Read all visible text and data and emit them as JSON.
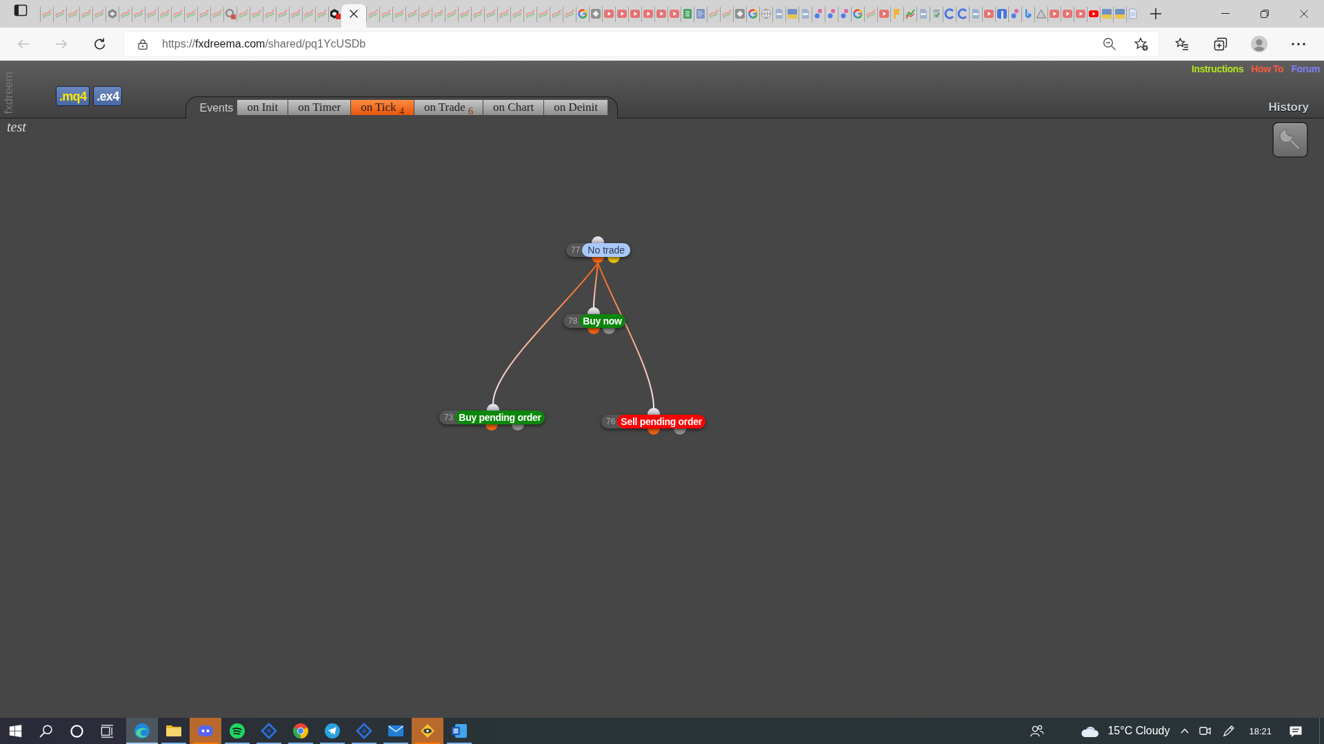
{
  "browser": {
    "tabs": [
      {
        "kind": "fx",
        "selected": false
      },
      {
        "kind": "fx",
        "selected": false
      },
      {
        "kind": "fx",
        "selected": false
      },
      {
        "kind": "fx",
        "selected": false
      },
      {
        "kind": "fx",
        "selected": false
      },
      {
        "kind": "hex",
        "selected": false
      },
      {
        "kind": "fx",
        "selected": false
      },
      {
        "kind": "fx",
        "selected": false
      },
      {
        "kind": "fx",
        "selected": false
      },
      {
        "kind": "fx",
        "selected": false
      },
      {
        "kind": "fx",
        "selected": false
      },
      {
        "kind": "fx",
        "selected": false
      },
      {
        "kind": "fx",
        "selected": false
      },
      {
        "kind": "fx",
        "selected": false
      },
      {
        "kind": "ring",
        "selected": false
      },
      {
        "kind": "fx",
        "selected": false
      },
      {
        "kind": "fx",
        "selected": false
      },
      {
        "kind": "fx",
        "selected": false
      },
      {
        "kind": "fx",
        "selected": false
      },
      {
        "kind": "fx",
        "selected": false
      },
      {
        "kind": "fx",
        "selected": false
      },
      {
        "kind": "fx",
        "selected": false
      },
      {
        "kind": "hexbadge",
        "selected": false
      },
      {
        "selected": true
      },
      {
        "kind": "fx",
        "selected": false
      },
      {
        "kind": "fx",
        "selected": false
      },
      {
        "kind": "fx",
        "selected": false
      },
      {
        "kind": "fx",
        "selected": false
      },
      {
        "kind": "fx",
        "selected": false
      },
      {
        "kind": "fx",
        "selected": false
      },
      {
        "kind": "fx",
        "selected": false
      },
      {
        "kind": "fx",
        "selected": false
      },
      {
        "kind": "fx",
        "selected": false
      },
      {
        "kind": "fx",
        "selected": false
      },
      {
        "kind": "fx",
        "selected": false
      },
      {
        "kind": "fx",
        "selected": false
      },
      {
        "kind": "fx",
        "selected": false
      },
      {
        "kind": "fx",
        "selected": false
      },
      {
        "kind": "fx",
        "selected": false
      },
      {
        "kind": "fx",
        "selected": false
      },
      {
        "kind": "g",
        "selected": false
      },
      {
        "kind": "tile",
        "selected": false
      },
      {
        "kind": "play",
        "selected": false
      },
      {
        "kind": "play",
        "selected": false
      },
      {
        "kind": "play",
        "selected": false
      },
      {
        "kind": "play",
        "selected": false
      },
      {
        "kind": "play",
        "selected": false
      },
      {
        "kind": "play",
        "selected": false
      },
      {
        "kind": "sheet",
        "selected": false
      },
      {
        "kind": "doc",
        "selected": false
      },
      {
        "kind": "fx",
        "selected": false
      },
      {
        "kind": "fx",
        "selected": false
      },
      {
        "kind": "tile",
        "selected": false
      },
      {
        "kind": "g",
        "selected": false
      },
      {
        "kind": "globe",
        "selected": false
      },
      {
        "kind": "sql",
        "selected": false
      },
      {
        "kind": "mq5",
        "selected": false
      },
      {
        "kind": "sql",
        "selected": false
      },
      {
        "kind": "dots",
        "selected": false
      },
      {
        "kind": "dots",
        "selected": false
      },
      {
        "kind": "dots",
        "selected": false
      },
      {
        "kind": "g",
        "selected": false
      },
      {
        "kind": "fx",
        "selected": false
      },
      {
        "kind": "play",
        "selected": false
      },
      {
        "kind": "flag",
        "selected": false
      },
      {
        "kind": "chart",
        "selected": false
      },
      {
        "kind": "sql",
        "selected": false
      },
      {
        "kind": "db",
        "selected": false
      },
      {
        "kind": "c",
        "selected": false
      },
      {
        "kind": "c",
        "selected": false
      },
      {
        "kind": "sql",
        "selected": false
      },
      {
        "kind": "play",
        "selected": false
      },
      {
        "kind": "f",
        "selected": false
      },
      {
        "kind": "dots",
        "selected": false
      },
      {
        "kind": "b",
        "selected": false
      },
      {
        "kind": "tri",
        "selected": false
      },
      {
        "kind": "play",
        "selected": false
      },
      {
        "kind": "play",
        "selected": false
      },
      {
        "kind": "play",
        "selected": false
      },
      {
        "kind": "yt",
        "selected": false
      },
      {
        "kind": "mq5",
        "selected": false
      },
      {
        "kind": "mq5",
        "selected": false
      },
      {
        "kind": "page",
        "selected": false
      }
    ],
    "back": {
      "disabled": true
    },
    "forward": {
      "disabled": true
    },
    "address": {
      "prefix": "https://",
      "domain": "fxdreema.com",
      "rest": "/shared/pq1YcUSDb"
    }
  },
  "page": {
    "brand": "fxdreem",
    "files": [
      {
        "label": ".mq4",
        "color": "#ffe600"
      },
      {
        "label": ".ex4",
        "color": "#ffffff"
      }
    ],
    "events": {
      "label": "Events",
      "tabs": [
        {
          "label": "on Init",
          "selected": false
        },
        {
          "label": "on Timer",
          "selected": false
        },
        {
          "label": "on Tick",
          "count": "4",
          "selected": true
        },
        {
          "label": "on Trade",
          "count": "6",
          "selected": false
        },
        {
          "label": "on Chart",
          "selected": false
        },
        {
          "label": "on Deinit",
          "selected": false
        }
      ]
    },
    "links": [
      {
        "label": "Instructions",
        "color": "#b4e61e"
      },
      {
        "label": "How To",
        "color": "#ff5a3c"
      },
      {
        "label": "Forum",
        "color": "#7f7fff"
      }
    ],
    "history": "History",
    "project": "test"
  },
  "diagram": {
    "blocks": [
      {
        "number": "77",
        "label": "No trade",
        "kind": "condition",
        "color": "#a9c9fb",
        "children": [
          {
            "number": "78",
            "label": "Buy now",
            "kind": "action",
            "color": "#0b870b"
          },
          {
            "number": "73",
            "label": "Buy pending order",
            "kind": "action",
            "color": "#0b870b"
          },
          {
            "number": "76",
            "label": "Sell pending order",
            "kind": "action",
            "color": "#fa0000"
          }
        ]
      }
    ]
  },
  "taskbar": {
    "apps": [
      {
        "kind": "wave",
        "selected": true,
        "flashing": false
      },
      {
        "kind": "folder",
        "selected": false,
        "flashing": false
      },
      {
        "kind": "chat",
        "selected": false,
        "flashing": true
      },
      {
        "kind": "music",
        "selected": false,
        "flashing": false
      },
      {
        "kind": "diamond",
        "selected": false,
        "flashing": false
      },
      {
        "kind": "browser",
        "selected": false,
        "flashing": false
      },
      {
        "kind": "plane",
        "selected": false,
        "flashing": false
      },
      {
        "kind": "diamond",
        "selected": false,
        "flashing": false
      },
      {
        "kind": "mail",
        "selected": false,
        "flashing": false
      },
      {
        "kind": "eye",
        "selected": false,
        "flashing": true
      },
      {
        "kind": "doc",
        "selected": false,
        "flashing": false
      }
    ],
    "weather": "15°C Cloudy",
    "clock": "18:21"
  }
}
